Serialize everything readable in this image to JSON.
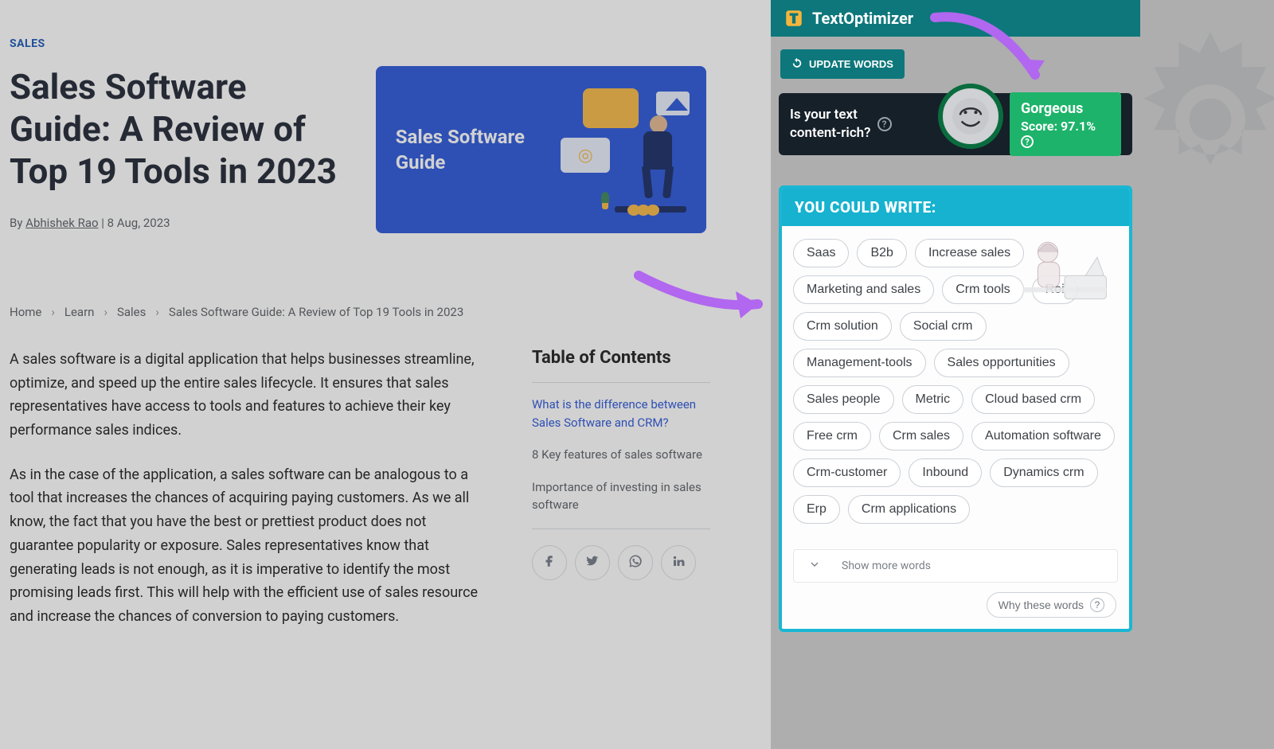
{
  "article": {
    "category_label": "SALES",
    "title": "Sales Software Guide: A Review of Top 19 Tools in 2023",
    "byline_prefix": "By ",
    "author": "Abhishek Rao",
    "byline_separator": " | ",
    "date": "8 Aug, 2023",
    "hero_title": "Sales Software Guide",
    "breadcrumbs": {
      "home": "Home",
      "learn": "Learn",
      "sales": "Sales",
      "current": "Sales Software Guide: A Review of Top 19 Tools in 2023"
    },
    "paragraphs": [
      "A sales software is a digital application that helps businesses streamline, optimize, and speed up the entire sales lifecycle. It ensures that sales representatives have access to tools and features to achieve their key performance sales indices.",
      "As in the case of the application, a sales software can be analogous to a tool that increases the chances of acquiring paying customers. As we all know, the fact that you have the best or prettiest product does not guarantee popularity or exposure. Sales representatives know that generating leads is not enough, as it is imperative to identify the most promising leads first. This will help with the efficient use of sales resource and increase the chances of conversion to paying customers."
    ],
    "toc": {
      "heading": "Table of Contents",
      "items": [
        "What is the difference between Sales Software and CRM?",
        "8 Key features of sales software",
        "Importance of investing in sales software"
      ]
    },
    "share": {
      "facebook": "facebook-icon",
      "twitter": "twitter-icon",
      "whatsapp": "whatsapp-icon",
      "linkedin": "linkedin-icon"
    }
  },
  "text_optimizer": {
    "brand": "TextOptimizer",
    "update_label": "UPDATE WORDS",
    "score_panel": {
      "question_line1": "Is your text",
      "question_line2": "content-rich?",
      "gorgeous": "Gorgeous",
      "score_label": "Score: 97.1%"
    },
    "suggest_title": "YOU COULD WRITE:",
    "chips": [
      "Saas",
      "B2b",
      "Increase sales",
      "Marketing and sales",
      "Crm tools",
      "Roi",
      "Crm solution",
      "Social crm",
      "Management-tools",
      "Sales opportunities",
      "Sales people",
      "Metric",
      "Cloud based crm",
      "Free crm",
      "Crm sales",
      "Automation software",
      "Crm-customer",
      "Inbound",
      "Dynamics crm",
      "Erp",
      "Crm applications"
    ],
    "show_more_label": "Show more words",
    "why_words_label": "Why these words"
  }
}
